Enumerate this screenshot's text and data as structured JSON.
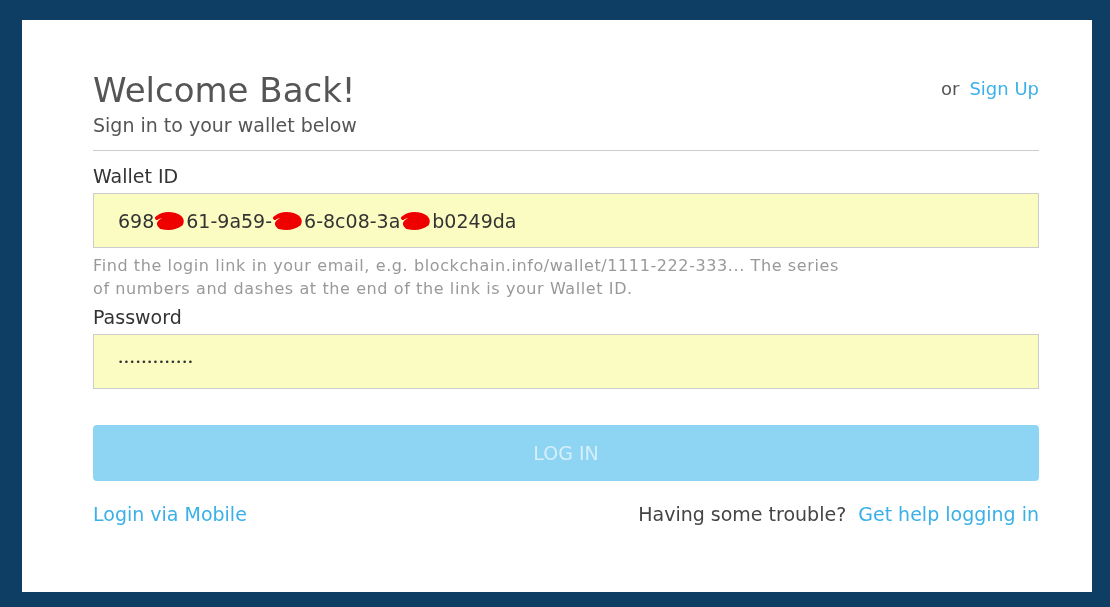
{
  "header": {
    "title": "Welcome Back!",
    "subtitle": "Sign in to your wallet below",
    "alt_prefix": "or",
    "alt_link": "Sign Up"
  },
  "wallet_id": {
    "label": "Wallet ID",
    "segments": [
      {
        "kind": "text",
        "text": "698"
      },
      {
        "kind": "redaction"
      },
      {
        "kind": "text",
        "text": "61-9a59-"
      },
      {
        "kind": "redaction"
      },
      {
        "kind": "text",
        "text": "6-8c08-3a"
      },
      {
        "kind": "redaction"
      },
      {
        "kind": "text",
        "text": "b0249da"
      }
    ],
    "help": "Find the login link in your email,  e.g. blockchain.info/wallet/1111-222-333...  The series of numbers and dashes at the end of the link is your Wallet ID."
  },
  "password": {
    "label": "Password",
    "value": "•••••••••••••"
  },
  "login_button": {
    "label": "LOG IN",
    "disabled": true
  },
  "footer": {
    "mobile_link": "Login via Mobile",
    "trouble_text": "Having some trouble?",
    "help_link": "Get help logging in"
  }
}
